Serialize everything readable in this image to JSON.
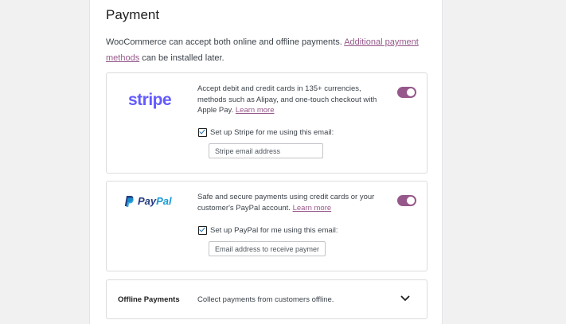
{
  "payment": {
    "title": "Payment",
    "intro_text": "WooCommerce can accept both online and offline payments. ",
    "intro_link": "Additional payment methods",
    "intro_suffix": " can be installed later."
  },
  "stripe": {
    "logo_text": "stripe",
    "description": "Accept debit and credit cards in 135+ currencies, methods such as Alipay, and one-touch checkout with Apple Pay. ",
    "learn_more": "Learn more",
    "toggle_on": true,
    "checkbox_label": "Set up Stripe for me using this email:",
    "checkbox_checked": true,
    "email_placeholder": "Stripe email address"
  },
  "paypal": {
    "logo_text_pay": "Pay",
    "logo_text_pal": "Pal",
    "description": "Safe and secure payments using credit cards or your customer's PayPal account. ",
    "learn_more": "Learn more",
    "toggle_on": true,
    "checkbox_label": "Set up PayPal for me using this email:",
    "checkbox_checked": true,
    "email_placeholder": "Email address to receive payments"
  },
  "offline": {
    "title": "Offline Payments",
    "description": "Collect payments from customers offline."
  },
  "colors": {
    "accent": "#96588a",
    "stripe_brand": "#635bff",
    "paypal_dark": "#253b80",
    "paypal_light": "#179bd7"
  },
  "icons": {
    "paypal": "paypal-logo-icon",
    "chevron": "chevron-down-icon"
  }
}
